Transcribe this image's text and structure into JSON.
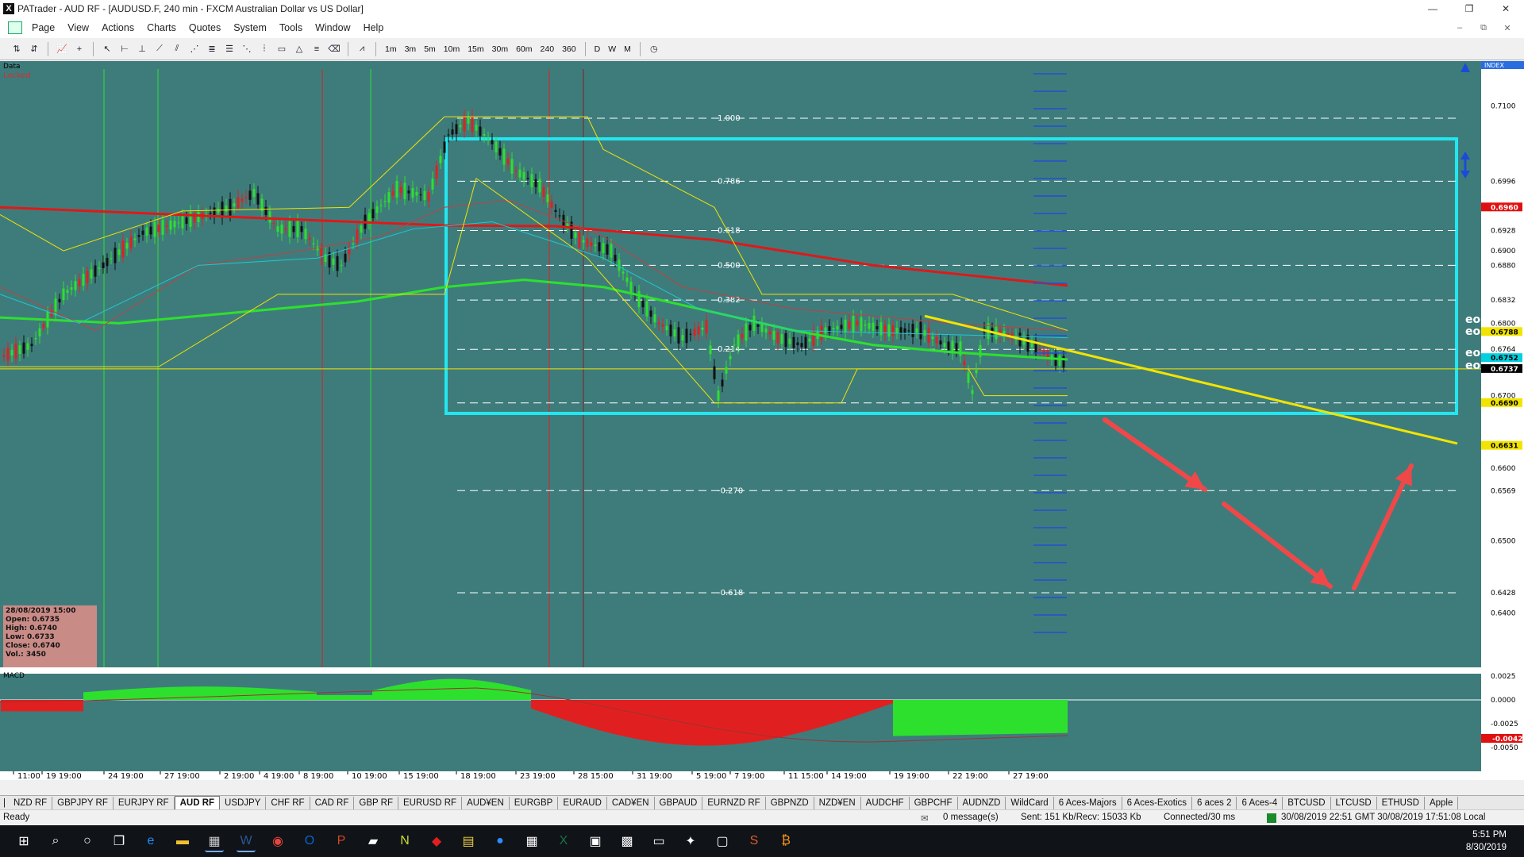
{
  "window": {
    "title": "PATrader - AUD RF - [AUDUSD.F, 240 min - FXCM Australian Dollar vs US Dollar]",
    "app_icon": "X",
    "controls": [
      "—",
      "❐",
      "✕"
    ],
    "mdi_controls": [
      "–",
      "⧉",
      "✕"
    ]
  },
  "menu": [
    "Page",
    "View",
    "Actions",
    "Charts",
    "Quotes",
    "System",
    "Tools",
    "Window",
    "Help"
  ],
  "toolbar": {
    "timeframes": [
      "1m",
      "3m",
      "5m",
      "10m",
      "15m",
      "30m",
      "60m",
      "240",
      "360"
    ],
    "periods": [
      "D",
      "W",
      "M"
    ]
  },
  "chart": {
    "data_label": "Data",
    "locked_label": "Locked",
    "index_label": "INDEX",
    "macd_label": "MACD",
    "fib_levels": [
      {
        "label": "1.000",
        "price": 0.7083
      },
      {
        "label": "0.786",
        "price": 0.6996
      },
      {
        "label": "0.618",
        "price": 0.6928
      },
      {
        "label": "0.500",
        "price": 0.688
      },
      {
        "label": "0.382",
        "price": 0.6832
      },
      {
        "label": "0.214",
        "price": 0.6764
      },
      {
        "label": "",
        "price": 0.669
      },
      {
        "label": "-0.270",
        "price": 0.6569
      },
      {
        "label": "-0.618",
        "price": 0.6428
      }
    ],
    "price_axis": [
      "0.7100",
      "0.6996",
      "0.6960",
      "0.6928",
      "0.6900",
      "0.6880",
      "0.6832",
      "0.6800",
      "0.6788",
      "0.6764",
      "0.6752",
      "0.6737",
      "0.6700",
      "0.6690",
      "0.6631",
      "0.6600",
      "0.6569",
      "0.6500",
      "0.6428",
      "0.6400"
    ],
    "price_tags": [
      {
        "value": "0.6960",
        "color": "#e01010"
      },
      {
        "value": "0.6788",
        "color": "#f2e400"
      },
      {
        "value": "0.6752",
        "color": "#00d0e0"
      },
      {
        "value": "0.6737",
        "color": "#000000"
      },
      {
        "value": "0.6690",
        "color": "#f2e400"
      },
      {
        "value": "0.6631",
        "color": "#f2e400"
      }
    ],
    "macd_axis": [
      "0.0025",
      "0.0000",
      "-0.0025",
      "-0.0050"
    ],
    "macd_tag": "-0.0042",
    "date_axis": [
      "11:00",
      "19 19:00",
      "24 19:00",
      "27 19:00",
      "2 19:00",
      "4 19:00",
      "8 19:00",
      "10 19:00",
      "15 19:00",
      "18 19:00",
      "23 19:00",
      "28 15:00",
      "31 19:00",
      "5 19:00",
      "7 19:00",
      "11 15:00",
      "14 19:00",
      "19 19:00",
      "22 19:00",
      "27 19:00"
    ],
    "colors": {
      "background": "#3e7c7c",
      "box": "#22e6f0",
      "ema_slow": "#e01818",
      "ema_fast": "#2ee02e",
      "trendline": "#f2e400",
      "arrows": "#f04848"
    }
  },
  "ohlc": {
    "date": "28/08/2019 15:00",
    "open": "Open: 0.6735",
    "high": "High: 0.6740",
    "low": "Low: 0.6733",
    "close": "Close: 0.6740",
    "vol": "Vol.: 3450"
  },
  "tabs": [
    "NZD RF",
    "GBPJPY RF",
    "EURJPY RF",
    "AUD RF",
    "USDJPY",
    "CHF RF",
    "CAD RF",
    "GBP RF",
    "EURUSD RF",
    "AUD¥EN",
    "EURGBP",
    "EURAUD",
    "CAD¥EN",
    "GBPAUD",
    "EURNZD RF",
    "GBPNZD",
    "NZD¥EN",
    "AUDCHF",
    "GBPCHF",
    "AUDNZD",
    "WildCard",
    "6 Aces-Majors",
    "6 Aces-Exotics",
    "6 aces 2",
    "6 Aces-4",
    "BTCUSD",
    "LTCUSD",
    "ETHUSD",
    "Apple"
  ],
  "active_tab": "AUD RF",
  "status": {
    "ready": "Ready",
    "messages": "0 message(s)",
    "traffic": "Sent: 151 Kb/Recv: 15033 Kb",
    "connection": "Connected/30 ms",
    "times": "30/08/2019 22:51 GMT  30/08/2019 17:51:08 Local"
  },
  "taskbar": {
    "time": "5:51 PM",
    "date": "8/30/2019",
    "apps": [
      "start-icon",
      "search-icon",
      "cortana-icon",
      "taskview-icon",
      "edge-icon",
      "explorer-icon",
      "patrader-icon",
      "word-icon",
      "chrome-icon",
      "outlook-icon",
      "powerpoint-icon",
      "notes-icon",
      "ninjatrader-icon",
      "app-red-icon",
      "sticky-icon",
      "zoom-icon",
      "calculator-icon",
      "excel-icon",
      "app-blue-icon",
      "photo-icon",
      "files-icon",
      "app-gear-icon",
      "app-gray-icon",
      "snagit-icon",
      "bitcoin-icon"
    ]
  }
}
